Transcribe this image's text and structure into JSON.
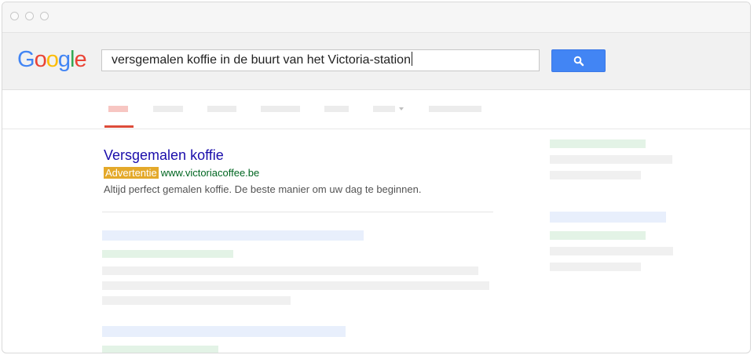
{
  "search": {
    "query": "versgemalen koffie in de buurt van het Victoria-station"
  },
  "logo": {
    "letters": [
      "G",
      "o",
      "o",
      "g",
      "l",
      "e"
    ],
    "colors": [
      "#4285f4",
      "#ea4335",
      "#fbbc05",
      "#4285f4",
      "#34a853",
      "#ea4335"
    ]
  },
  "ad": {
    "title": "Versgemalen koffie",
    "badge": "Advertentie",
    "url": "www.victoriacoffee.be",
    "description": "Altijd perfect gemalen koffie. De beste manier om uw dag te beginnen."
  },
  "colors": {
    "search_button": "#4285f4",
    "ad_badge": "#e4a92a",
    "link_title": "#1a0dab",
    "url_green": "#006621",
    "active_tab": "#dd4b39"
  }
}
